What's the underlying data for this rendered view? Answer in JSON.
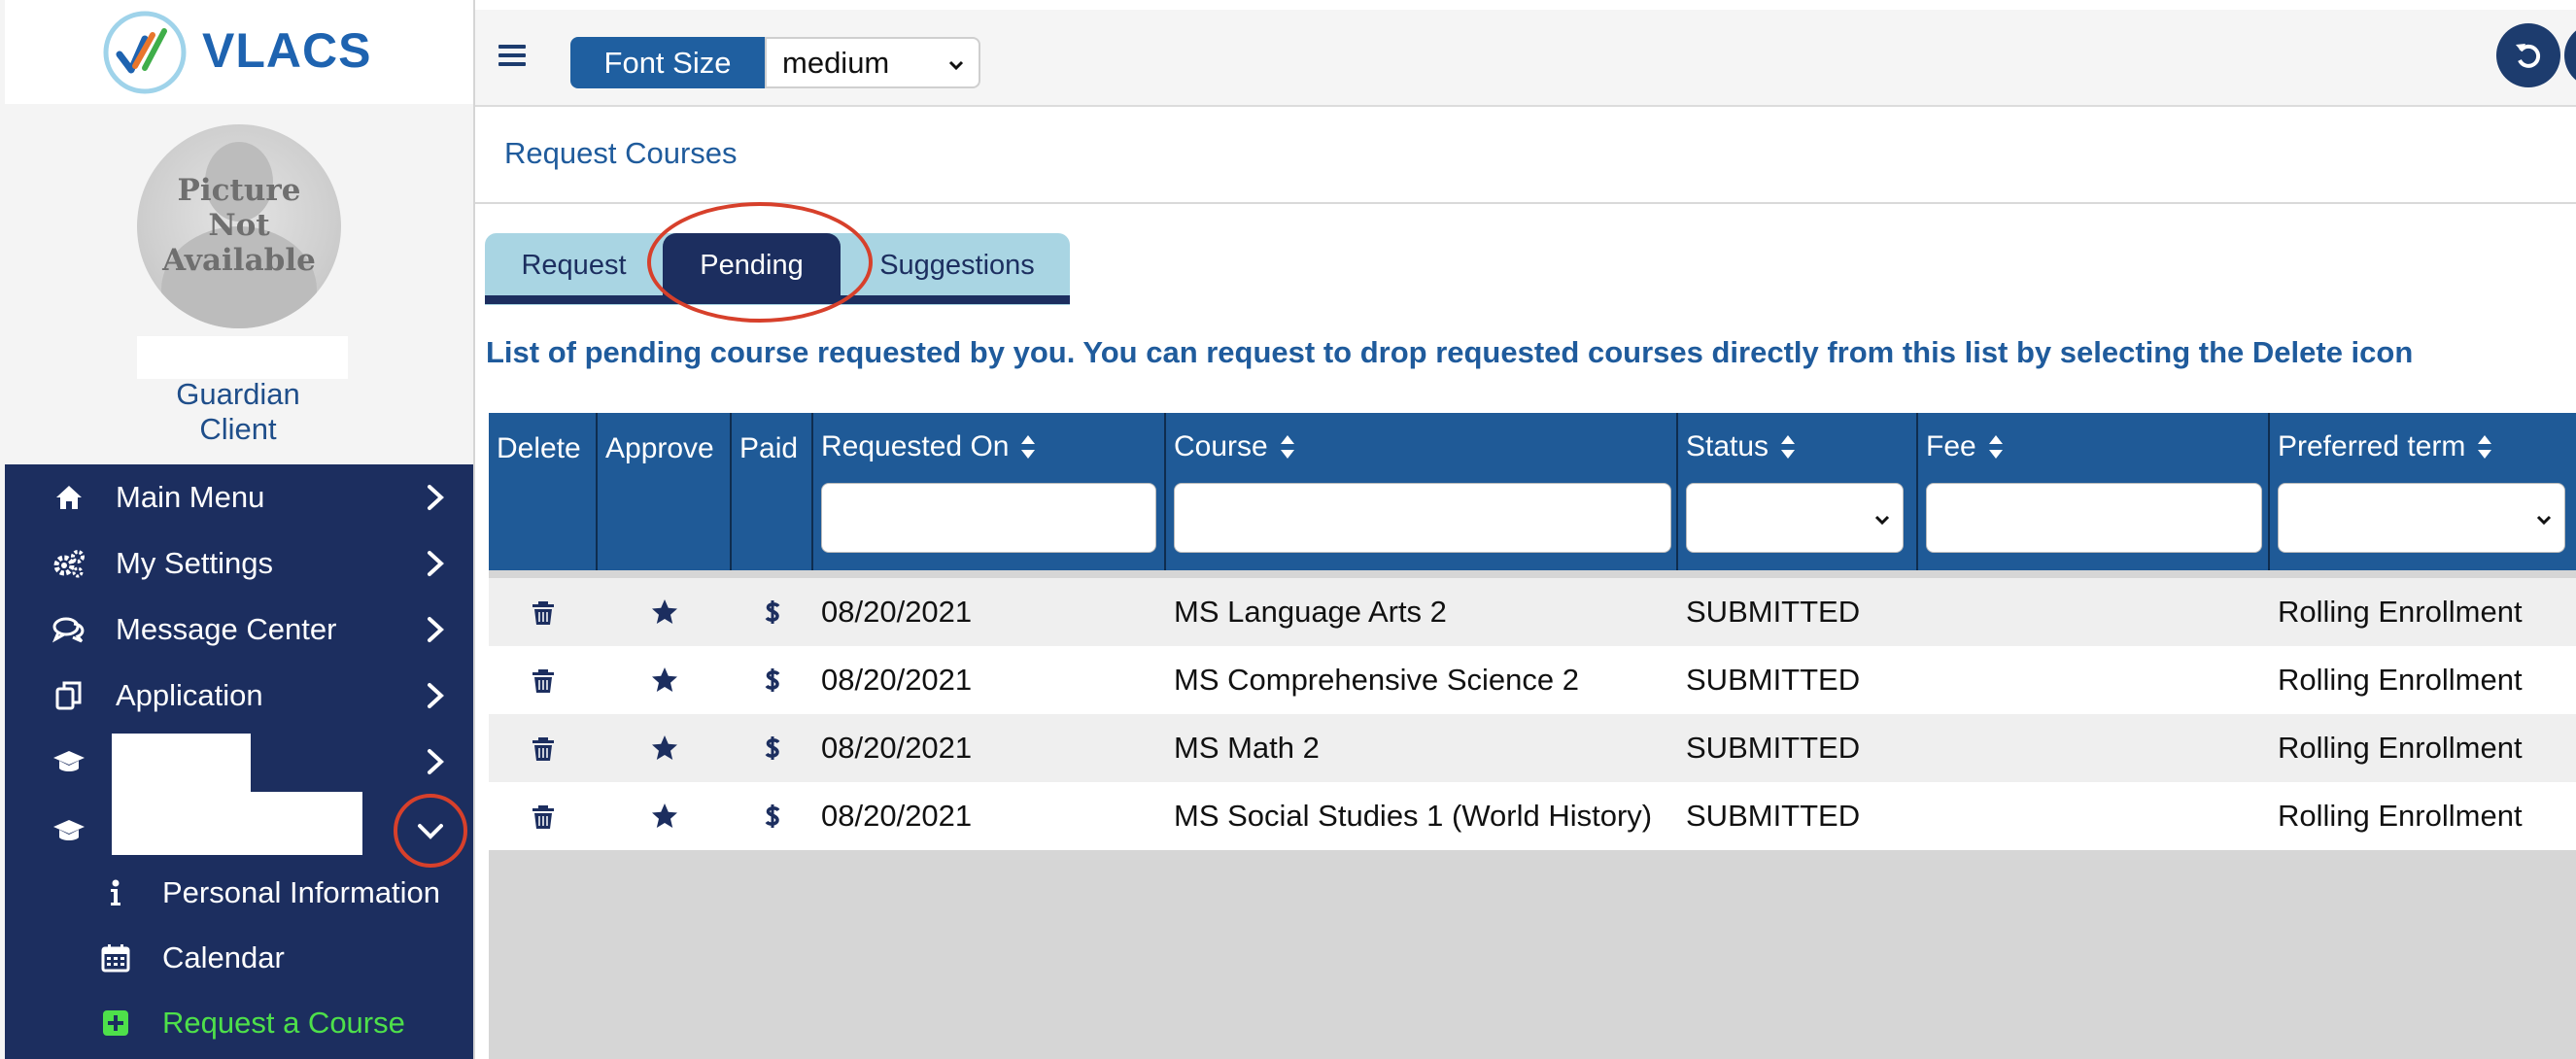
{
  "app": {
    "logo_text": "VLACS"
  },
  "profile": {
    "avatar_text_line1": "Picture",
    "avatar_text_line2": "Not",
    "avatar_text_line3": "Available",
    "role_line1": "Guardian",
    "role_line2": "Client"
  },
  "sidebar": {
    "items": [
      {
        "label": "Main Menu",
        "icon": "home-icon"
      },
      {
        "label": "My Settings",
        "icon": "gears-icon"
      },
      {
        "label": "Message Center",
        "icon": "chat-icon"
      },
      {
        "label": "Application",
        "icon": "copy-icon"
      },
      {
        "label": "",
        "icon": "graduation-cap-icon",
        "redacted": true
      },
      {
        "label": "",
        "icon": "graduation-cap-icon",
        "redacted": true,
        "expanded": true
      }
    ],
    "subitems": [
      {
        "label": "Personal Information",
        "icon": "info-icon"
      },
      {
        "label": "Calendar",
        "icon": "calendar-icon"
      },
      {
        "label": "Request a Course",
        "icon": "plus-square-icon",
        "active": true
      }
    ]
  },
  "toolbar": {
    "font_size_label": "Font Size",
    "font_size_value": "medium"
  },
  "page": {
    "title": "Request Courses",
    "tabs": [
      {
        "label": "Request",
        "active": false
      },
      {
        "label": "Pending",
        "active": true
      },
      {
        "label": "Suggestions",
        "active": false
      }
    ],
    "instructions": "List of pending course requested by you. You can request to drop requested courses directly from this list by selecting the Delete icon"
  },
  "table": {
    "columns": [
      "Delete",
      "Approve",
      "Paid",
      "Requested On",
      "Course",
      "Status",
      "Fee",
      "Preferred term"
    ],
    "rows": [
      {
        "requested_on": "08/20/2021",
        "course": "MS Language Arts 2",
        "status": "SUBMITTED",
        "fee": "",
        "preferred_term": "Rolling Enrollment"
      },
      {
        "requested_on": "08/20/2021",
        "course": "MS Comprehensive Science 2",
        "status": "SUBMITTED",
        "fee": "",
        "preferred_term": "Rolling Enrollment"
      },
      {
        "requested_on": "08/20/2021",
        "course": "MS Math 2",
        "status": "SUBMITTED",
        "fee": "",
        "preferred_term": "Rolling Enrollment"
      },
      {
        "requested_on": "08/20/2021",
        "course": "MS Social Studies 1 (World History)",
        "status": "SUBMITTED",
        "fee": "",
        "preferred_term": "Rolling Enrollment"
      }
    ]
  },
  "colors": {
    "nav_bg": "#1c2e5f",
    "header_blue": "#1f5a97",
    "accent_green": "#4ee04a",
    "annotation_red": "#d7402b",
    "link_blue": "#1f5b9c"
  }
}
